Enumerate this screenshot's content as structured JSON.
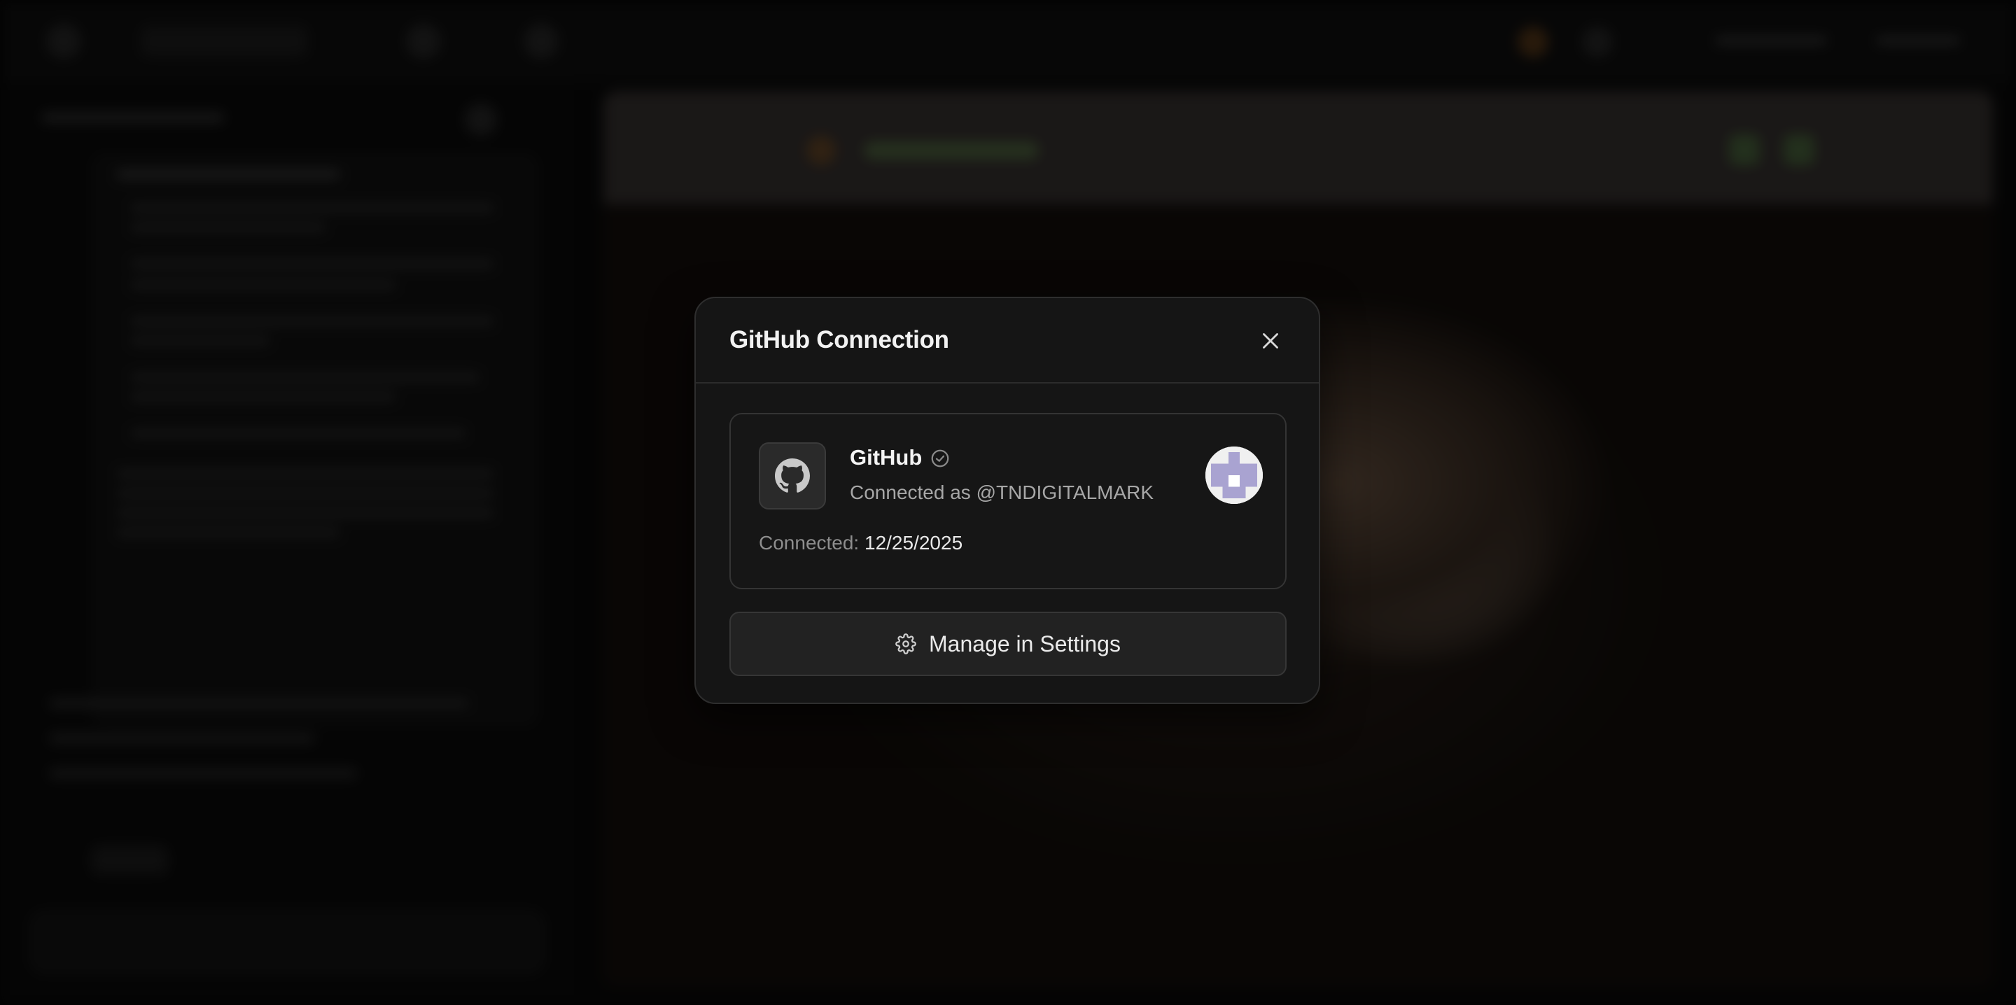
{
  "modal": {
    "title": "GitHub Connection",
    "close_icon": "close-icon"
  },
  "connection": {
    "provider_icon": "github-icon",
    "provider_name": "GitHub",
    "verified_icon": "check-circle-icon",
    "account_text": "Connected as @TNDIGITALMARK",
    "connected_label": "Connected:",
    "connected_date": "12/25/2025",
    "avatar_icon": "identicon-avatar"
  },
  "actions": {
    "manage_icon": "gear-icon",
    "manage_label": "Manage in Settings"
  },
  "colors": {
    "modal_bg": "#151515",
    "card_border": "#343434",
    "button_bg": "#222222",
    "avatar_purple": "#a9a3d1"
  }
}
